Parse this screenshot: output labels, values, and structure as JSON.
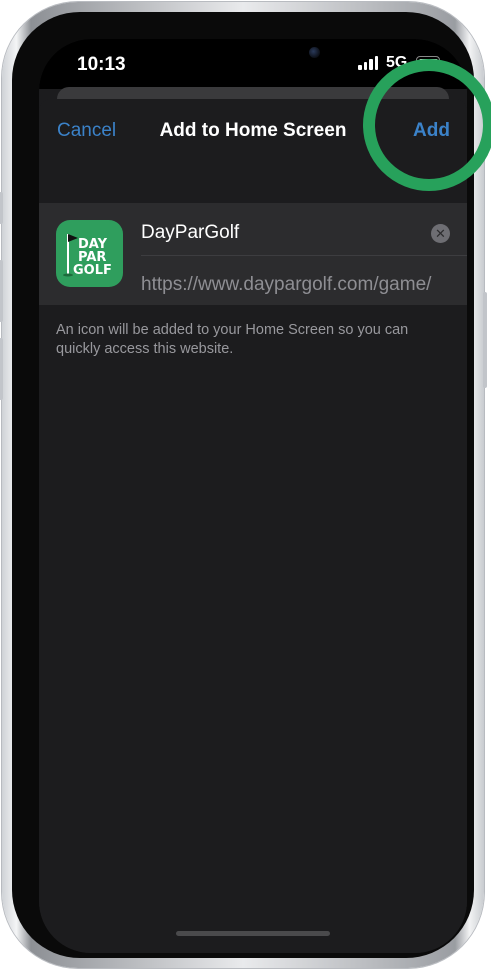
{
  "status_bar": {
    "time": "10:13",
    "network": "5G",
    "icons": [
      "signal-bars-icon",
      "battery-icon"
    ]
  },
  "sheet": {
    "cancel_label": "Cancel",
    "title": "Add to Home Screen",
    "add_label": "Add"
  },
  "bookmark": {
    "name": "DayParGolf",
    "url": "https://www.daypargolf.com/game/",
    "icon_lines": [
      "DAY",
      "PAR",
      "GOLF"
    ],
    "icon_color": "#2f9e5d",
    "clear_icon": "x-circle-icon"
  },
  "hint": "An icon will be added to your Home Screen so you can quickly access this website.",
  "colors": {
    "accent": "#3b82c9",
    "highlight_ring": "#27a15b",
    "sheet_background": "#1c1c1e",
    "card_background": "#2c2c2e"
  }
}
